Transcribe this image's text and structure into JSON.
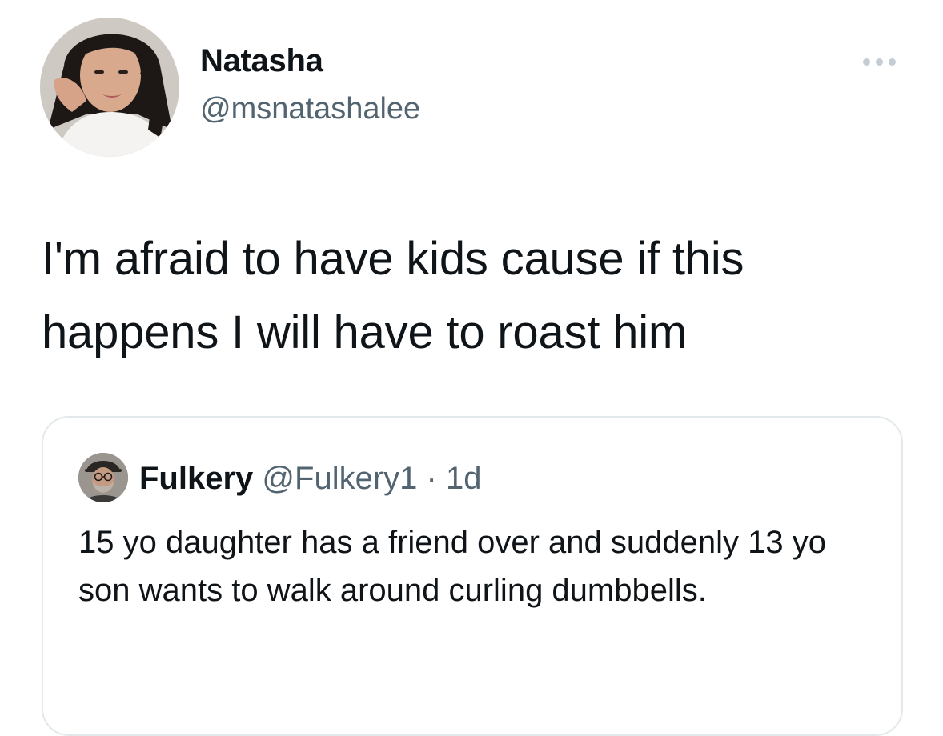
{
  "tweet": {
    "author": {
      "display_name": "Natasha",
      "handle": "@msnatashalee",
      "avatar_icon": "profile-photo"
    },
    "more_icon": "more-horizontal-icon",
    "text": "I'm afraid to have kids cause if this happens I will have to roast him",
    "quoted_tweet": {
      "author": {
        "display_name": "Fulkery",
        "handle": "@Fulkery1",
        "separator": "·",
        "time": "1d",
        "avatar_icon": "profile-photo"
      },
      "text": "15 yo daughter has a friend over and suddenly 13 yo son wants to walk around curling dumbbells."
    }
  },
  "colors": {
    "text_primary": "#0f1419",
    "text_secondary": "#536471",
    "border": "#e3e8eb",
    "icon_muted": "#c4cdd4"
  }
}
